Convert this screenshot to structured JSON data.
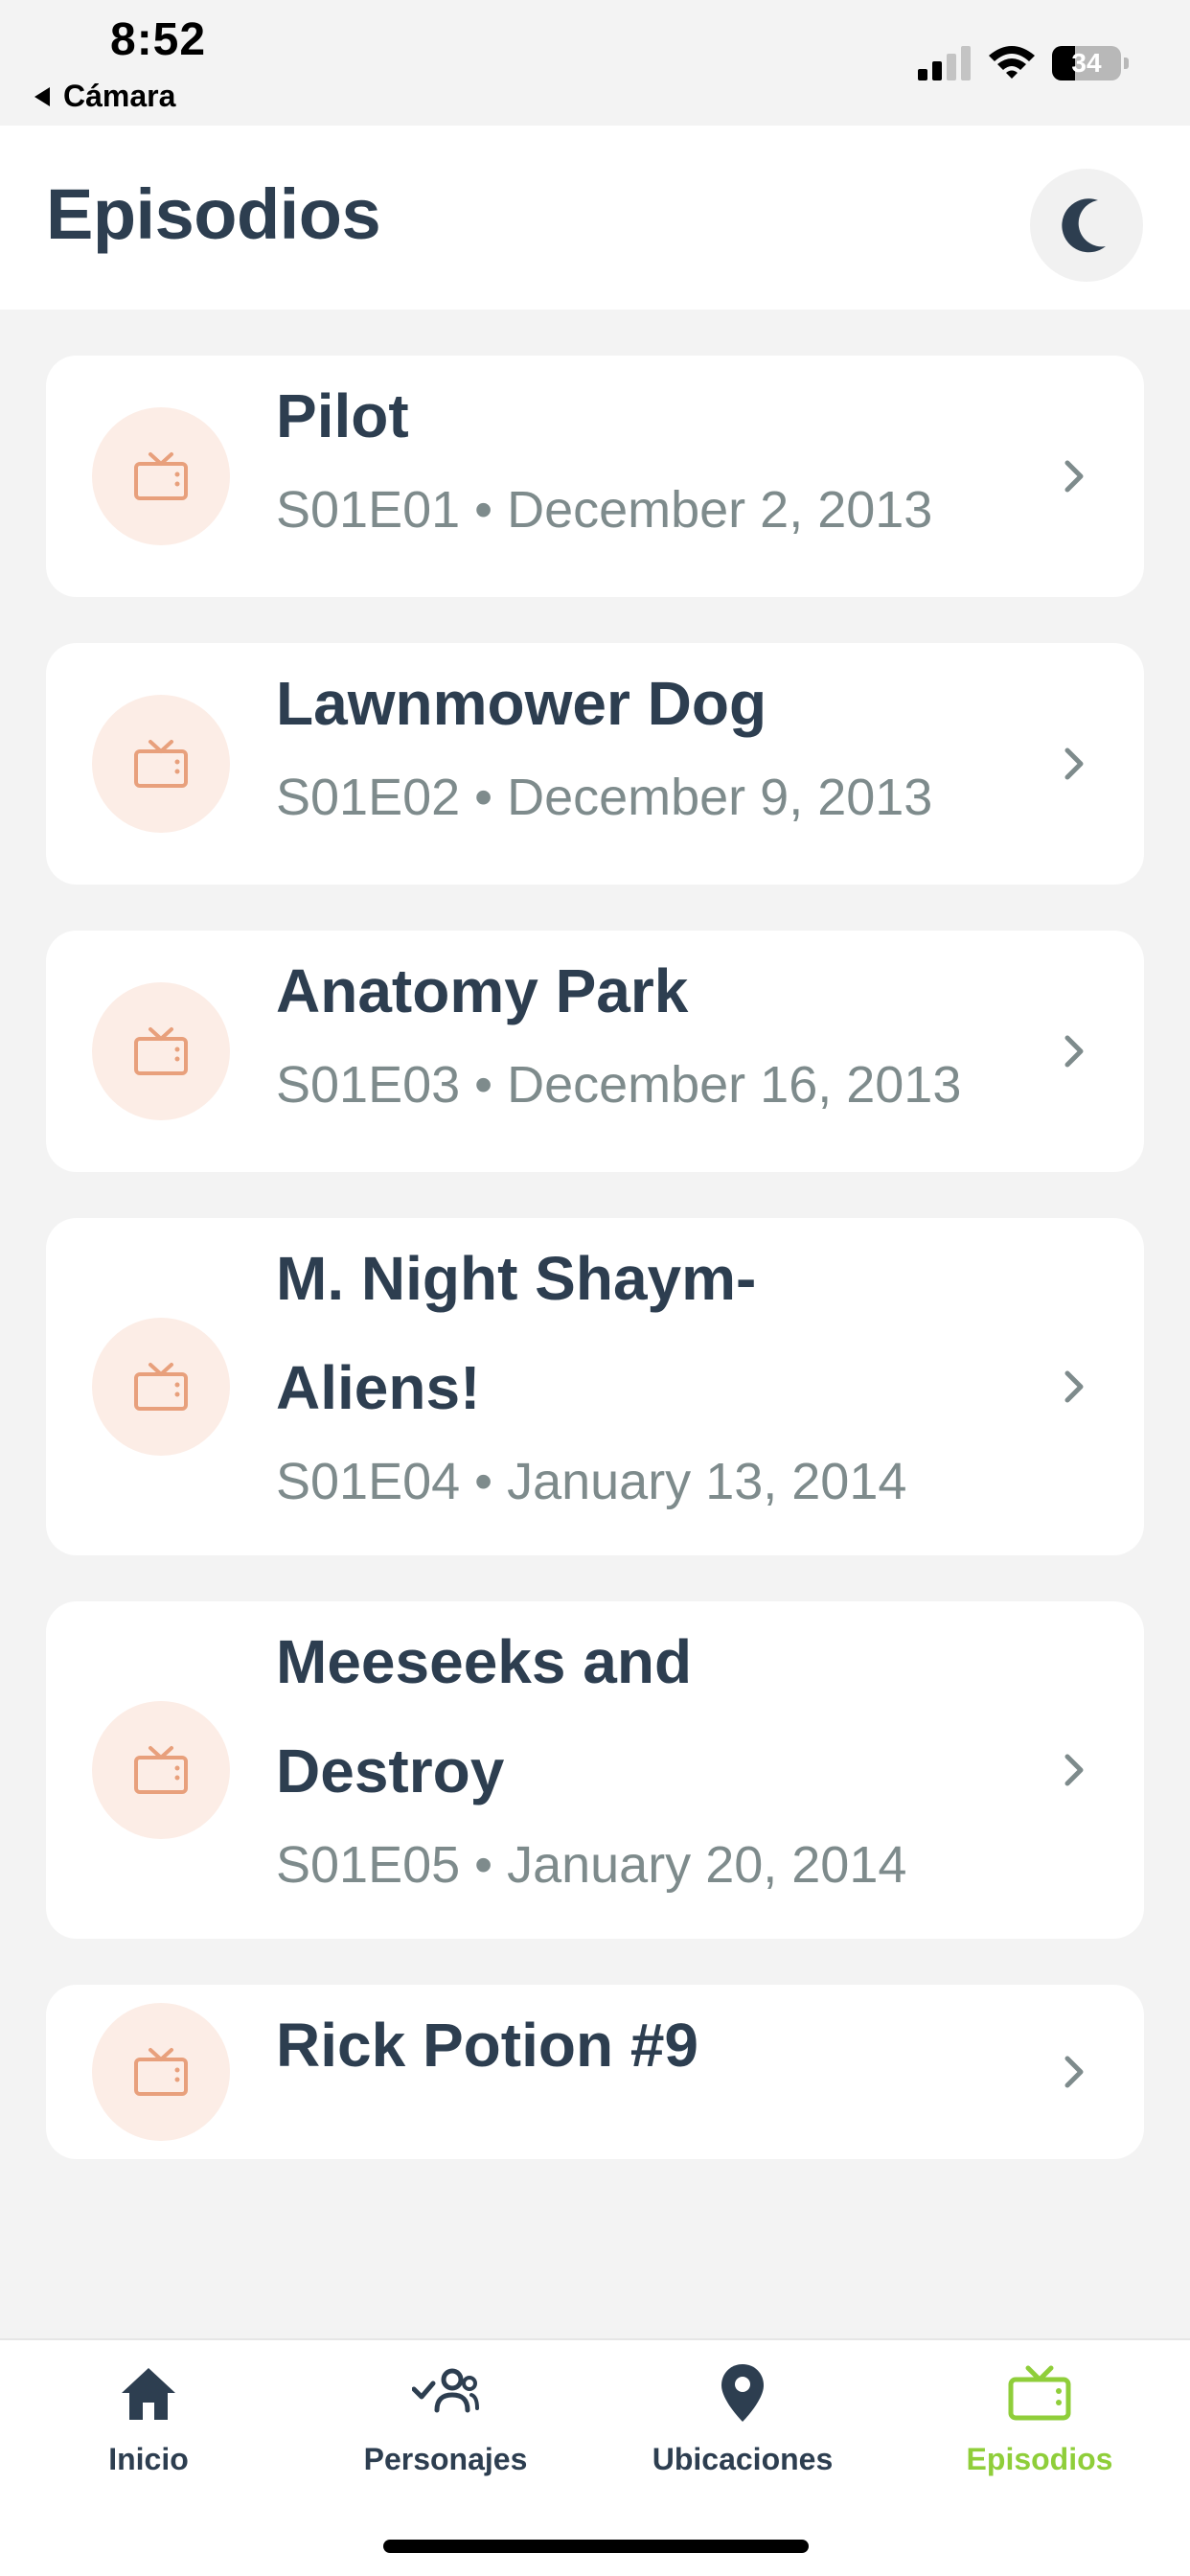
{
  "status_bar": {
    "time": "8:52",
    "back_app": "Cámara",
    "battery_level": "34"
  },
  "header": {
    "title": "Episodios",
    "theme_toggle_icon": "moon-icon"
  },
  "episodes": [
    {
      "name_lines": [
        "Pilot"
      ],
      "code": "S01E01",
      "air_date": "December 2, 2013",
      "meta": "S01E01 • December 2, 2013"
    },
    {
      "name_lines": [
        "Lawnmower Dog"
      ],
      "code": "S01E02",
      "air_date": "December 9, 2013",
      "meta": "S01E02 • December 9, 2013"
    },
    {
      "name_lines": [
        "Anatomy Park"
      ],
      "code": "S01E03",
      "air_date": "December 16, 2013",
      "meta": "S01E03 • December 16, 2013"
    },
    {
      "name_lines": [
        "M. Night Shaym-",
        "Aliens!"
      ],
      "code": "S01E04",
      "air_date": "January 13, 2014",
      "meta": "S01E04 • January 13, 2014"
    },
    {
      "name_lines": [
        "Meeseeks and",
        "Destroy"
      ],
      "code": "S01E05",
      "air_date": "January 20, 2014",
      "meta": "S01E05 • January 20, 2014"
    },
    {
      "name_lines": [
        "Rick Potion #9"
      ],
      "code": "",
      "air_date": "",
      "meta": ""
    }
  ],
  "tab_bar": {
    "tabs": [
      {
        "label": "Inicio",
        "icon": "home-icon"
      },
      {
        "label": "Personajes",
        "icon": "people-icon"
      },
      {
        "label": "Ubicaciones",
        "icon": "location-pin-icon"
      },
      {
        "label": "Episodios",
        "icon": "tv-icon",
        "active": true
      }
    ]
  },
  "colors": {
    "title_text": "#2d3e50",
    "meta_text": "#7e8b8c",
    "tv_icon": "#e8a07c",
    "tv_icon_bg": "#fcede6",
    "active_tab": "#8fce3a",
    "background": "#f3f3f3",
    "card": "#ffffff"
  }
}
